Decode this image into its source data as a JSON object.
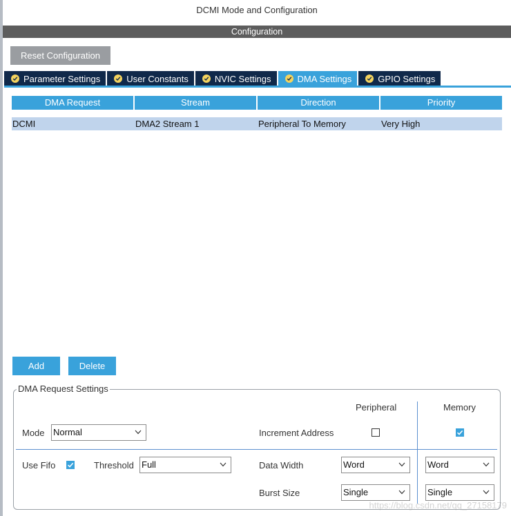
{
  "window": {
    "title": "DCMI Mode and Configuration"
  },
  "config_bar": {
    "title": "Configuration"
  },
  "reset_button": {
    "label": "Reset Configuration"
  },
  "tabs": [
    {
      "label": "Parameter Settings",
      "icon": "check-circle-icon",
      "active": false
    },
    {
      "label": "User Constants",
      "icon": "check-circle-icon",
      "active": false
    },
    {
      "label": "NVIC Settings",
      "icon": "check-circle-icon",
      "active": false
    },
    {
      "label": "DMA Settings",
      "icon": "check-circle-icon",
      "active": true
    },
    {
      "label": "GPIO Settings",
      "icon": "check-circle-icon",
      "active": false
    }
  ],
  "table": {
    "headers": [
      "DMA Request",
      "Stream",
      "Direction",
      "Priority"
    ],
    "rows": [
      {
        "request": "DCMI",
        "stream": "DMA2 Stream 1",
        "direction": "Peripheral To Memory",
        "priority": "Very High"
      }
    ]
  },
  "actions": {
    "add_label": "Add",
    "delete_label": "Delete"
  },
  "settings": {
    "legend": "DMA Request Settings",
    "peripheral_header": "Peripheral",
    "memory_header": "Memory",
    "mode_label": "Mode",
    "mode_value": "Normal",
    "increment_label": "Increment Address",
    "increment_peripheral": false,
    "increment_memory": true,
    "use_fifo_label": "Use Fifo",
    "use_fifo": true,
    "threshold_label": "Threshold",
    "threshold_value": "Full",
    "data_width_label": "Data Width",
    "data_width_peripheral": "Word",
    "data_width_memory": "Word",
    "burst_size_label": "Burst Size",
    "burst_size_peripheral": "Single",
    "burst_size_memory": "Single"
  },
  "watermark": "https://blog.csdn.net/qq_27158179",
  "colors": {
    "accent": "#39a2db",
    "tab_dark": "#10294a",
    "config_bar": "#5d5d5d",
    "selected_row": "#c0d4ec"
  }
}
